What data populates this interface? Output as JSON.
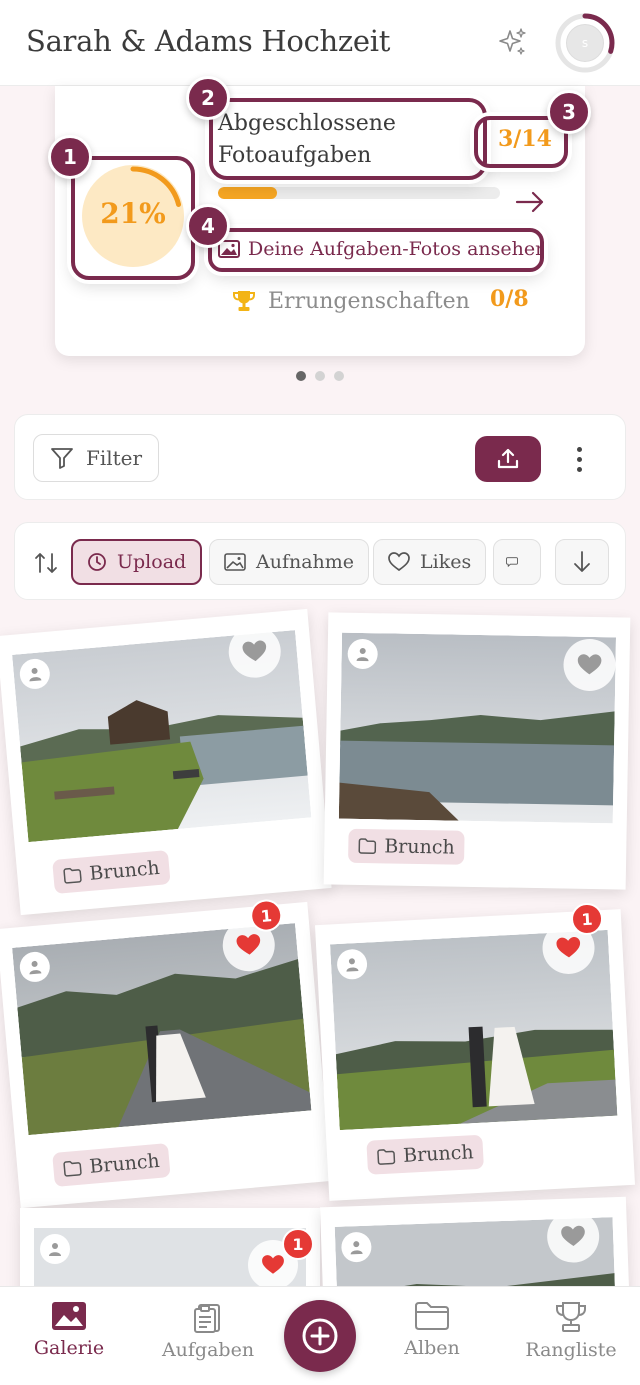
{
  "header": {
    "title": "Sarah & Adams Hochzeit",
    "sparkle_icon": "sparkle-icon",
    "avatar_initial": "s",
    "avatar_ring_progress": 0.3
  },
  "progress_card": {
    "percent_text": "21%",
    "percent_value": 0.21,
    "tasks_label": "Abgeschlossene Fotoaufgaben",
    "tasks_count": "3/14",
    "tasks_progress": 0.21,
    "view_photos_label": "Deine Aufgaben-Fotos ansehen",
    "achievements_label": "Errungenschaften",
    "achievements_count": "0/8",
    "carousel_active_index": 0,
    "carousel_count": 3
  },
  "onboarding": {
    "steps": [
      "1",
      "2",
      "3",
      "4"
    ]
  },
  "toolbar": {
    "filter_label": "Filter",
    "upload_icon": "upload-icon",
    "more_icon": "more-vertical-icon"
  },
  "sort": {
    "chips": [
      {
        "label": "Upload",
        "icon": "clock-icon",
        "active": true
      },
      {
        "label": "Aufnahme",
        "icon": "image-icon",
        "active": false
      },
      {
        "label": "Likes",
        "icon": "heart-icon",
        "active": false
      },
      {
        "label": "",
        "icon": "comment-icon",
        "active": false
      }
    ],
    "direction_icon": "arrow-down-icon"
  },
  "photos": [
    {
      "album": "Brunch",
      "likes": "",
      "liked": false
    },
    {
      "album": "Brunch",
      "likes": "",
      "liked": false
    },
    {
      "album": "Brunch",
      "likes": "1",
      "liked": true
    },
    {
      "album": "Brunch",
      "likes": "1",
      "liked": true
    },
    {
      "album": "",
      "likes": "1",
      "liked": true
    },
    {
      "album": "",
      "likes": "",
      "liked": false
    }
  ],
  "nav": {
    "items": [
      {
        "label": "Galerie",
        "icon": "gallery-icon",
        "active": true
      },
      {
        "label": "Aufgaben",
        "icon": "clipboard-icon",
        "active": false
      },
      {
        "label": "Alben",
        "icon": "folder-icon",
        "active": false
      },
      {
        "label": "Rangliste",
        "icon": "trophy-icon",
        "active": false
      }
    ],
    "fab_icon": "add-icon"
  },
  "colors": {
    "brand": "#7a2a4d",
    "accent": "#f29a1c",
    "like": "#e53935"
  }
}
